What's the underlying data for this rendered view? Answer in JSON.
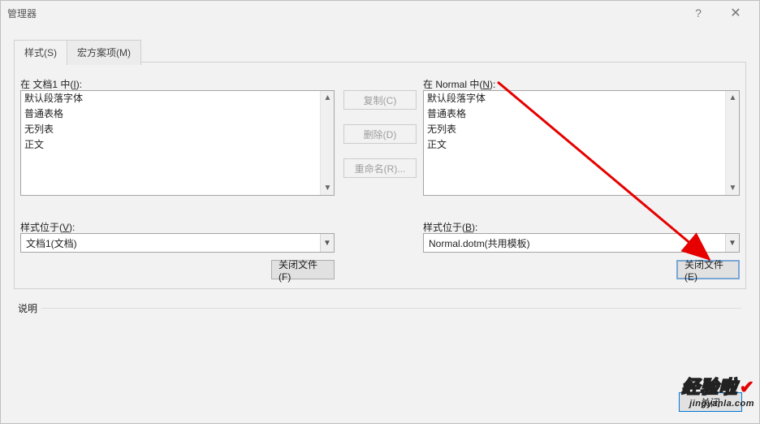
{
  "window": {
    "title": "管理器",
    "help": "?",
    "close": "✕"
  },
  "tabs": {
    "styles": "样式(S)",
    "macros": "宏方案项(M)"
  },
  "left": {
    "in_label_prefix": "在 文档1 中(",
    "in_label_key": "I",
    "in_label_suffix": "):",
    "items": [
      "默认段落字体",
      "普通表格",
      "无列表",
      "正文"
    ],
    "location_label_prefix": "样式位于(",
    "location_label_key": "V",
    "location_label_suffix": "):",
    "location_value": "文档1(文档)",
    "close_file": "关闭文件(F)"
  },
  "right": {
    "in_label_prefix": "在 Normal 中(",
    "in_label_key": "N",
    "in_label_suffix": "):",
    "items": [
      "默认段落字体",
      "普通表格",
      "无列表",
      "正文"
    ],
    "location_label_prefix": "样式位于(",
    "location_label_key": "B",
    "location_label_suffix": "):",
    "location_value": "Normal.dotm(共用模板)",
    "close_file": "关闭文件(E)"
  },
  "mid": {
    "copy": "复制(C)",
    "delete": "删除(D)",
    "rename": "重命名(R)..."
  },
  "desc": "说明",
  "footer_close": "关闭",
  "watermark": {
    "big": "经验啦",
    "url": "jingyanla.com"
  }
}
